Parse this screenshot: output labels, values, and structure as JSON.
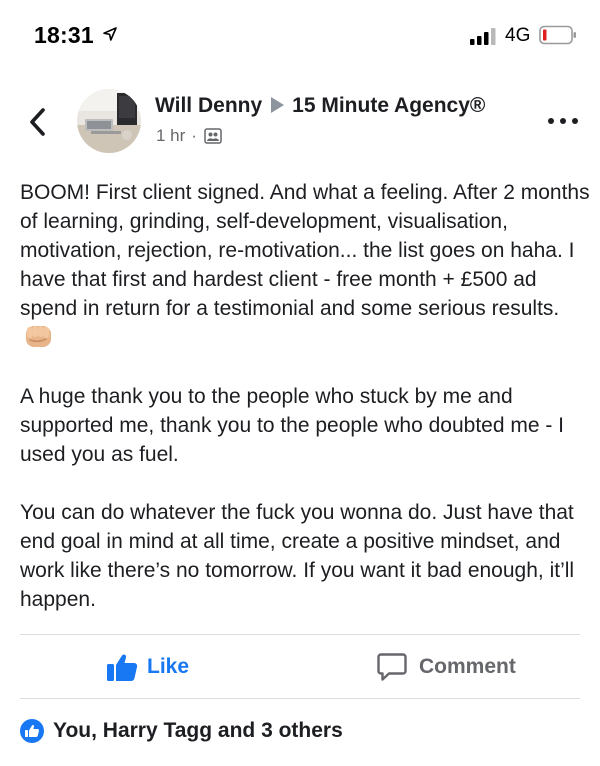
{
  "status_bar": {
    "time": "18:31",
    "network": "4G",
    "location_icon": "location-arrow-icon",
    "signal_icon": "cellular-signal-icon",
    "battery_icon": "battery-low-icon",
    "battery_color": "#e02020"
  },
  "header": {
    "back_icon": "chevron-left-icon",
    "author": "Will Denny",
    "separator_icon": "triangle-right-icon",
    "group": "15 Minute Agency®",
    "time_ago": "1 hr",
    "dot": "·",
    "audience_icon": "group-audience-icon",
    "more_icon": "more-options-icon"
  },
  "post": {
    "paragraphs": [
      "BOOM! First client signed. And what a feeling. After 2 months of learning, grinding, self-development, visualisation, motivation, rejection, re-motivation... the list goes on haha. I have that first and hardest client - free month + £500 ad spend in return for a testimonial and some serious results.",
      "A huge thank you to the people who stuck by me and supported me, thank you to the people who doubted me - I used you as fuel.",
      "You can do whatever the fuck you wonna do. Just have that end goal in mind at all time, create a positive mindset, and work like there’s no tomorrow. If you want it bad enough, it’ll happen."
    ],
    "emoji_icon": "fist-bump-emoji-icon"
  },
  "actions": {
    "like_label": "Like",
    "comment_label": "Comment",
    "like_color": "#1877f2",
    "comment_color": "#65676b"
  },
  "reactions": {
    "summary": "You, Harry Tagg and 3 others",
    "icon": "like-reaction-icon"
  }
}
